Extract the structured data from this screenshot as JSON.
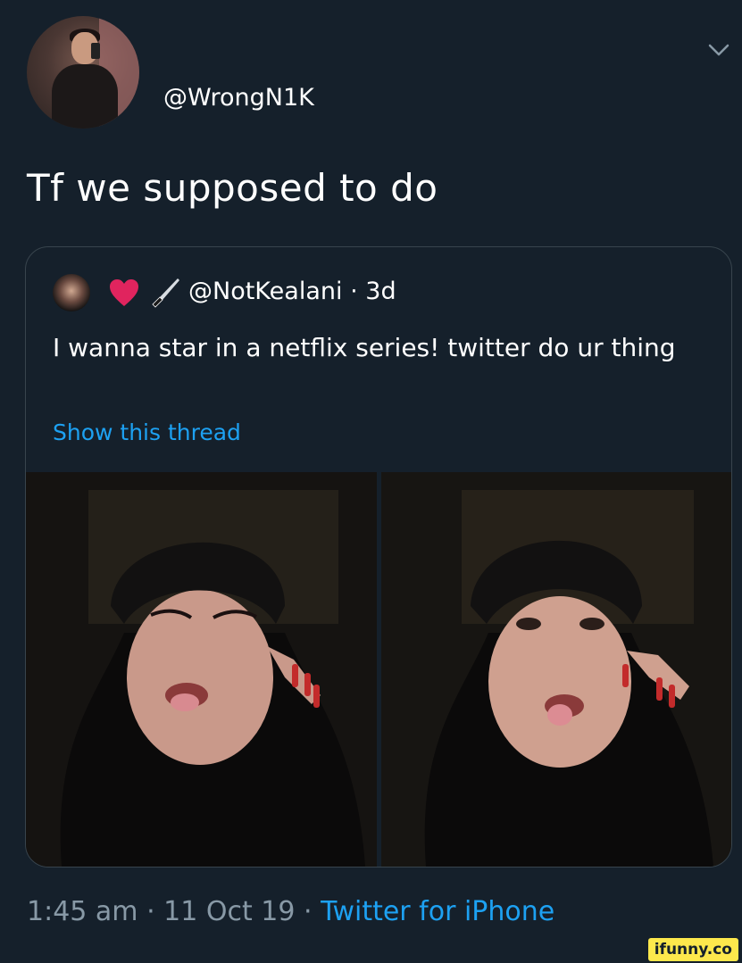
{
  "author": {
    "handle": "@WrongN1K",
    "text": "Tf we supposed to do"
  },
  "quoted": {
    "handle": "@NotKealani",
    "separator": "·",
    "time": "3d",
    "emoji_icons": [
      "heart-icon",
      "knife-icon"
    ],
    "text": "I wanna star in a netflix series! twitter do ur thing",
    "thread_link": "Show this thread",
    "media_count": 2
  },
  "footer": {
    "time": "1:45 am",
    "date": "11 Oct 19",
    "separator": "·",
    "source": "Twitter for iPhone"
  },
  "watermark": "ifunny.co",
  "colors": {
    "background": "#15202b",
    "link": "#1da1f2",
    "secondary_text": "#8899a6",
    "border": "#38444d",
    "heart": "#e0245e"
  }
}
